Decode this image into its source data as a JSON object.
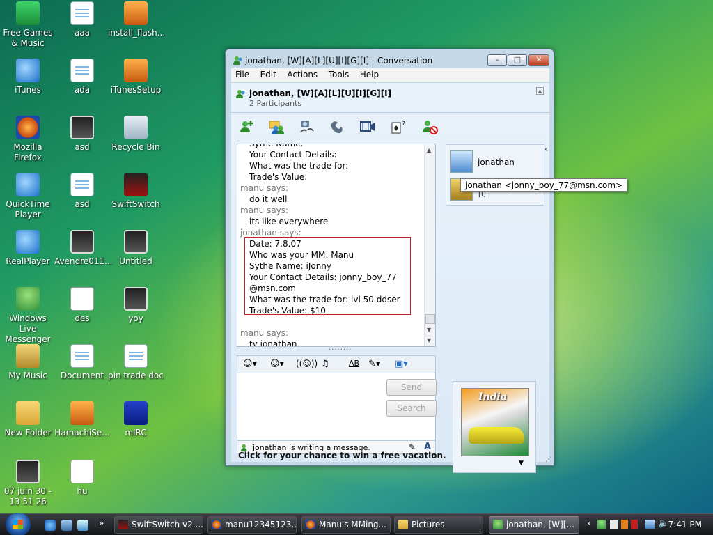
{
  "desktop": {
    "icons": [
      {
        "label": "Free Games & Music",
        "icon": "gift-icon"
      },
      {
        "label": "aaa",
        "icon": "document-icon"
      },
      {
        "label": "install_flash...",
        "icon": "installer-icon"
      },
      {
        "label": "iTunes",
        "icon": "itunes-icon"
      },
      {
        "label": "ada",
        "icon": "document-icon"
      },
      {
        "label": "iTunesSetup",
        "icon": "installer-icon"
      },
      {
        "label": "Mozilla Firefox",
        "icon": "firefox-icon"
      },
      {
        "label": "asd",
        "icon": "image-icon"
      },
      {
        "label": "Recycle Bin",
        "icon": "recycle-bin-icon"
      },
      {
        "label": "QuickTime Player",
        "icon": "quicktime-icon"
      },
      {
        "label": "asd",
        "icon": "document-icon"
      },
      {
        "label": "SwiftSwitch",
        "icon": "swiftswitch-icon"
      },
      {
        "label": "RealPlayer",
        "icon": "realplayer-icon"
      },
      {
        "label": "Avendre011...",
        "icon": "image-icon"
      },
      {
        "label": "Untitled",
        "icon": "image-icon"
      },
      {
        "label": "Windows Live Messenger",
        "icon": "messenger-icon"
      },
      {
        "label": "des",
        "icon": "blank-icon"
      },
      {
        "label": "yoy",
        "icon": "image-icon"
      },
      {
        "label": "My Music",
        "icon": "music-folder-icon"
      },
      {
        "label": "Document",
        "icon": "document-icon"
      },
      {
        "label": "pin trade doc",
        "icon": "document-icon"
      },
      {
        "label": "New Folder",
        "icon": "folder-icon"
      },
      {
        "label": "HamachiSe...",
        "icon": "hamachi-icon"
      },
      {
        "label": "mIRC",
        "icon": "mirc-icon"
      },
      {
        "label": "07 juin 30 - 13 51 26",
        "icon": "image-icon"
      },
      {
        "label": "hu",
        "icon": "blank-icon"
      }
    ]
  },
  "window": {
    "title": "jonathan, [W][A][L][U][I][G][I] - Conversation",
    "controls": {
      "minimize": "–",
      "maximize": "□",
      "close": "✕"
    },
    "menu": [
      "File",
      "Edit",
      "Actions",
      "Tools",
      "Help"
    ],
    "header": {
      "name": "jonathan, [W][A][L][U][I][G][I]",
      "participants": "2 Participants"
    },
    "toolbar": [
      "invite-contact-icon",
      "share-files-icon",
      "video-call-icon",
      "call-icon",
      "activities-icon",
      "games-icon",
      "block-contact-icon"
    ],
    "history": [
      {
        "text": "Sythe Name:",
        "type": "msg"
      },
      {
        "text": "Your Contact Details:",
        "type": "msg"
      },
      {
        "text": "What was the trade for:",
        "type": "msg"
      },
      {
        "text": "Trade's Value:",
        "type": "msg"
      },
      {
        "text": "manu says:",
        "type": "says"
      },
      {
        "text": "do it well",
        "type": "msg"
      },
      {
        "text": "manu says:",
        "type": "says"
      },
      {
        "text": "its like everywhere",
        "type": "msg"
      },
      {
        "text": "jonathan says:",
        "type": "says"
      },
      {
        "text": "Date: 7.8.07",
        "type": "msg"
      },
      {
        "text": "Who was your MM: Manu",
        "type": "msg"
      },
      {
        "text": "Sythe Name: iJonny",
        "type": "msg"
      },
      {
        "text": "Your Contact Details: jonny_boy_77",
        "type": "msg"
      },
      {
        "text": "@msn.com",
        "type": "msg"
      },
      {
        "text": "What was the trade for: lvl 50 ddser",
        "type": "msg"
      },
      {
        "text": "Trade's Value: $10",
        "type": "msg"
      },
      {
        "text": "manu says:",
        "type": "says"
      },
      {
        "text": "ty jonathan",
        "type": "msg"
      }
    ],
    "format_bar": [
      "emoticon-icon",
      "wink-icon",
      "nudge-icon",
      "voice-clip-icon",
      "font-icon",
      "background-icon",
      "ink-icon"
    ],
    "buttons": {
      "send": "Send",
      "search": "Search"
    },
    "status": "jonathan is writing a message.",
    "ad": "Click for your chance to win a free vacation.",
    "contacts": [
      {
        "name": "jonathan"
      },
      {
        "name": "[I]"
      }
    ],
    "tooltip": "jonathan <jonny_boy_77@msn.com>",
    "display_picture_text": "India"
  },
  "taskbar": {
    "tasks": [
      {
        "label": "SwiftSwitch v2....",
        "icon": "swiftswitch-icon"
      },
      {
        "label": "manu12345123...",
        "icon": "firefox-icon"
      },
      {
        "label": "Manu's MMing...",
        "icon": "firefox-icon"
      },
      {
        "label": "Pictures",
        "icon": "folder-icon"
      },
      {
        "label": "jonathan, [W][...",
        "icon": "messenger-icon",
        "active": true
      }
    ],
    "clock": "7:41 PM"
  }
}
